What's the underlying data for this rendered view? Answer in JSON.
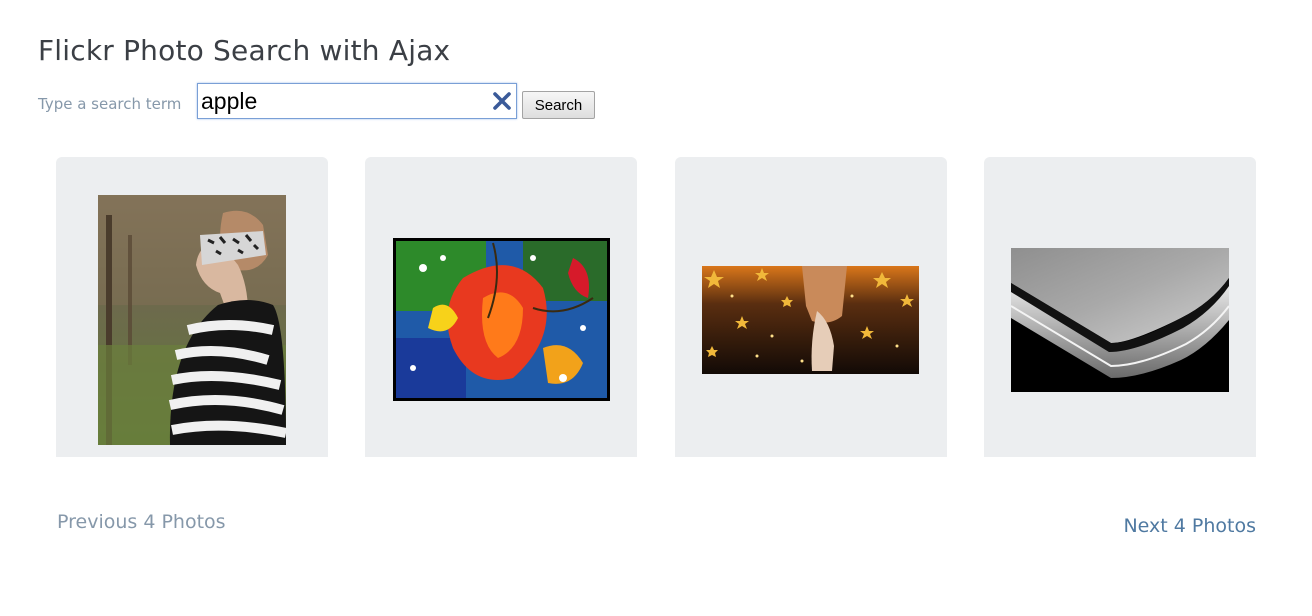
{
  "page": {
    "title": "Flickr Photo Search with Ajax"
  },
  "search": {
    "label": "Type a search term",
    "value": "apple",
    "clear_icon": "close-x-icon",
    "button_label": "Search"
  },
  "photos": [
    {
      "subject": "woman in zebra-striped fur coat, profile view, outdoors"
    },
    {
      "subject": "colorful abstract painting with red flower, black border"
    },
    {
      "subject": "golden stars and bokeh with couple, dark background"
    },
    {
      "subject": "close-up corner of silver aluminum laptop"
    }
  ],
  "pagination": {
    "prev_label": "Previous 4 Photos",
    "next_label": "Next 4 Photos"
  },
  "colors": {
    "title": "#3b3f45",
    "label": "#8698aa",
    "link_active": "#4f79a1",
    "card_bg": "#eceef0",
    "clear_icon": "#3a5a99"
  }
}
